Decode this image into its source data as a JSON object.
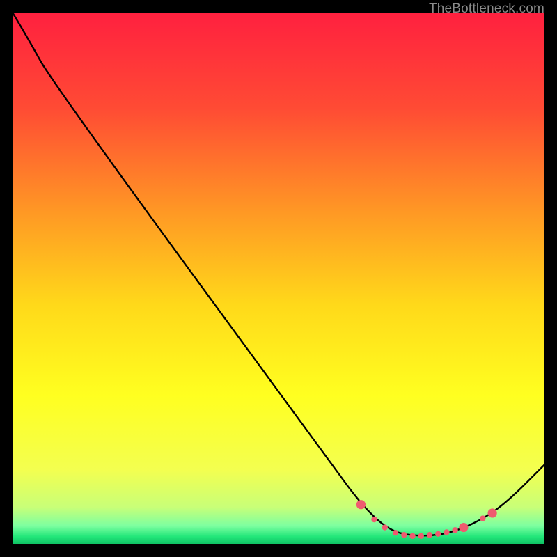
{
  "watermark": "TheBottleneck.com",
  "chart_data": {
    "type": "line",
    "title": "",
    "xlabel": "",
    "ylabel": "",
    "xlim": [
      0,
      100
    ],
    "ylim": [
      0,
      100
    ],
    "legend": false,
    "grid": false,
    "background_gradient_stops": [
      {
        "pos": 0.0,
        "color": "#ff203f"
      },
      {
        "pos": 0.18,
        "color": "#ff4b34"
      },
      {
        "pos": 0.38,
        "color": "#ff9a24"
      },
      {
        "pos": 0.55,
        "color": "#ffd91a"
      },
      {
        "pos": 0.72,
        "color": "#ffff20"
      },
      {
        "pos": 0.86,
        "color": "#f3ff50"
      },
      {
        "pos": 0.93,
        "color": "#c8ff78"
      },
      {
        "pos": 0.965,
        "color": "#7dffa0"
      },
      {
        "pos": 0.985,
        "color": "#23e77a"
      },
      {
        "pos": 1.0,
        "color": "#0dbf62"
      }
    ],
    "curve": {
      "comment": "x,y in percent of plot width/height, origin bottom-left",
      "points": [
        [
          0.0,
          100.0
        ],
        [
          3.0,
          95.0
        ],
        [
          7.4,
          87.0
        ],
        [
          60.0,
          15.0
        ],
        [
          66.0,
          7.0
        ],
        [
          71.0,
          2.5
        ],
        [
          76.0,
          1.5
        ],
        [
          82.0,
          2.0
        ],
        [
          88.0,
          4.5
        ],
        [
          93.0,
          8.0
        ],
        [
          100.0,
          15.0
        ]
      ]
    },
    "markers": {
      "color": "#ef5b6f",
      "radius_small": 4.2,
      "radius_large": 6.6,
      "points": [
        {
          "x": 65.5,
          "y": 7.5,
          "r": "large"
        },
        {
          "x": 68.0,
          "y": 4.7,
          "r": "small"
        },
        {
          "x": 70.0,
          "y": 3.2,
          "r": "small"
        },
        {
          "x": 72.0,
          "y": 2.2,
          "r": "small"
        },
        {
          "x": 73.6,
          "y": 1.8,
          "r": "small"
        },
        {
          "x": 75.2,
          "y": 1.6,
          "r": "small"
        },
        {
          "x": 76.8,
          "y": 1.6,
          "r": "small"
        },
        {
          "x": 78.4,
          "y": 1.8,
          "r": "small"
        },
        {
          "x": 80.0,
          "y": 2.0,
          "r": "small"
        },
        {
          "x": 81.6,
          "y": 2.3,
          "r": "small"
        },
        {
          "x": 83.2,
          "y": 2.7,
          "r": "small"
        },
        {
          "x": 84.8,
          "y": 3.2,
          "r": "large"
        },
        {
          "x": 88.4,
          "y": 4.9,
          "r": "small"
        },
        {
          "x": 90.2,
          "y": 5.9,
          "r": "large"
        }
      ]
    }
  }
}
